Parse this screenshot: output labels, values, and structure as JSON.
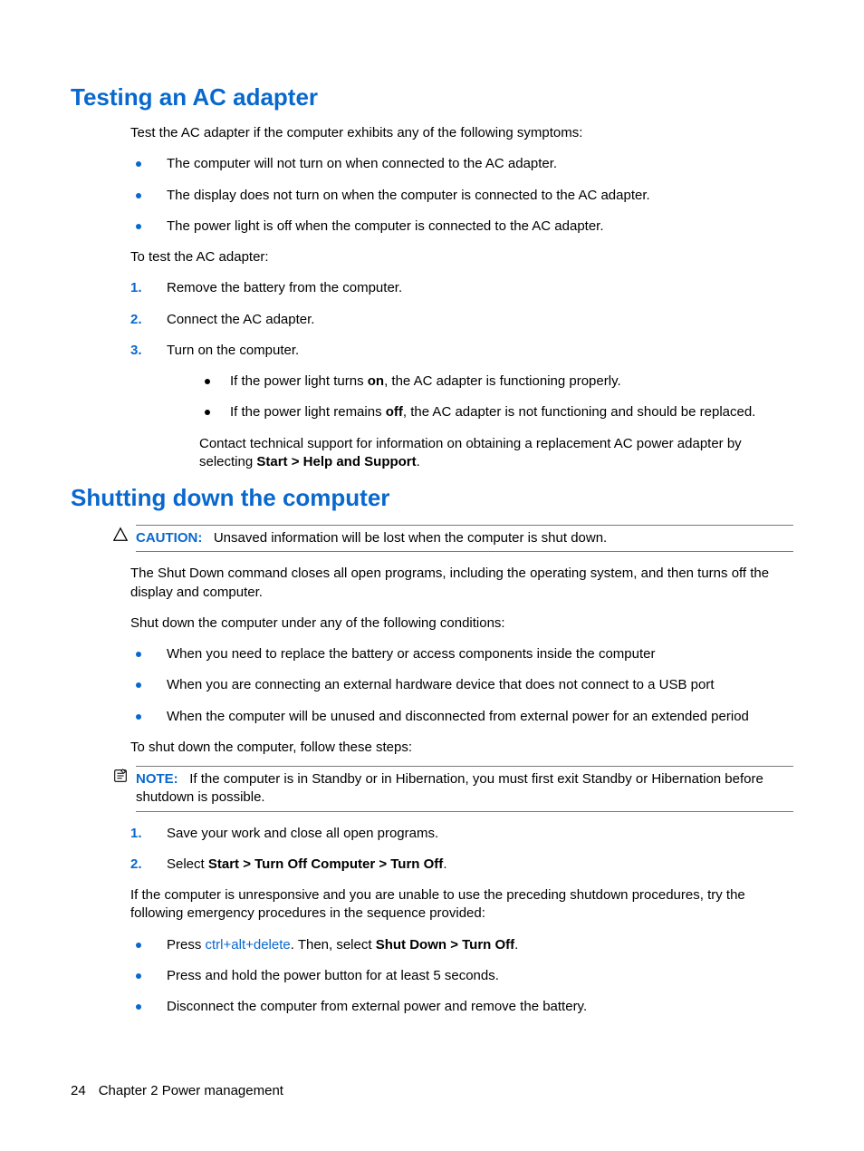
{
  "footer": {
    "page": "24",
    "chapter": "Chapter 2   Power management"
  },
  "s1": {
    "heading": "Testing an AC adapter",
    "intro": "Test the AC adapter if the computer exhibits any of the following symptoms:",
    "symptoms": [
      "The computer will not turn on when connected to the AC adapter.",
      "The display does not turn on when the computer is connected to the AC adapter.",
      "The power light is off when the computer is connected to the AC adapter."
    ],
    "totest": "To test the AC adapter:",
    "steps": [
      "Remove the battery from the computer.",
      "Connect the AC adapter.",
      "Turn on the computer."
    ],
    "sub": {
      "on_a": "If the power light turns ",
      "on_b": "on",
      "on_c": ", the AC adapter is functioning properly.",
      "off_a": "If the power light remains ",
      "off_b": "off",
      "off_c": ", the AC adapter is not functioning and should be replaced."
    },
    "contact_a": "Contact technical support for information on obtaining a replacement AC power adapter by selecting ",
    "contact_b": "Start > Help and Support",
    "contact_c": "."
  },
  "s2": {
    "heading": "Shutting down the computer",
    "caution_label": "CAUTION:",
    "caution_text": "Unsaved information will be lost when the computer is shut down.",
    "p1": "The Shut Down command closes all open programs, including the operating system, and then turns off the display and computer.",
    "p2": "Shut down the computer under any of the following conditions:",
    "conds": [
      "When you need to replace the battery or access components inside the computer",
      "When you are connecting an external hardware device that does not connect to a USB port",
      "When the computer will be unused and disconnected from external power for an extended period"
    ],
    "p3": "To shut down the computer, follow these steps:",
    "note_label": "NOTE:",
    "note_text": "If the computer is in Standby or in Hibernation, you must first exit Standby or Hibernation before shutdown is possible.",
    "step1": "Save your work and close all open programs.",
    "step2_a": "Select ",
    "step2_b": "Start > Turn Off Computer > Turn Off",
    "step2_c": ".",
    "p4": "If the computer is unresponsive and you are unable to use the preceding shutdown procedures, try the following emergency procedures in the sequence provided:",
    "em1_a": "Press ",
    "em1_b": "ctrl+alt+delete",
    "em1_c": ". Then, select ",
    "em1_d": "Shut Down > Turn Off",
    "em1_e": ".",
    "em2": "Press and hold the power button for at least 5 seconds.",
    "em3": "Disconnect the computer from external power and remove the battery."
  }
}
